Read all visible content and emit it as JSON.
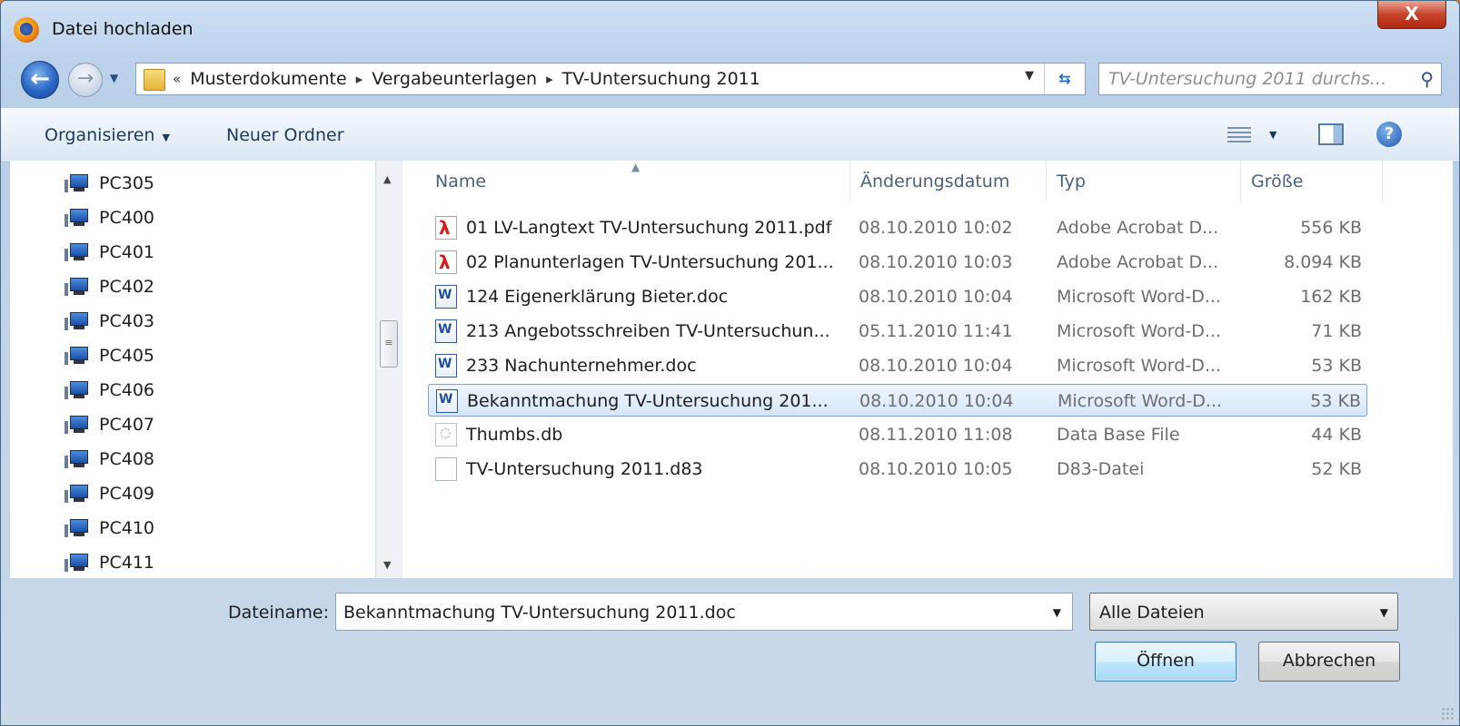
{
  "window": {
    "title": "Datei hochladen",
    "close_label": "X"
  },
  "address": {
    "overflow": "«",
    "crumbs": [
      "Musterdokumente",
      "Vergabeunterlagen",
      "TV-Untersuchung 2011"
    ],
    "separator": "▸",
    "search_placeholder": "TV-Untersuchung 2011 durchs..."
  },
  "toolbar": {
    "organize_label": "Organisieren",
    "new_folder_label": "Neuer Ordner"
  },
  "nav": {
    "items": [
      "PC305",
      "PC400",
      "PC401",
      "PC402",
      "PC403",
      "PC405",
      "PC406",
      "PC407",
      "PC408",
      "PC409",
      "PC410",
      "PC411"
    ]
  },
  "columns": {
    "name": "Name",
    "date": "Änderungsdatum",
    "type": "Typ",
    "size": "Größe"
  },
  "files": [
    {
      "name": "01 LV-Langtext TV-Untersuchung 2011.pdf",
      "date": "08.10.2010 10:02",
      "type": "Adobe Acrobat D...",
      "size": "556 KB",
      "icon": "pdf-icon"
    },
    {
      "name": "02 Planunterlagen TV-Untersuchung 201...",
      "date": "08.10.2010 10:03",
      "type": "Adobe Acrobat D...",
      "size": "8.094 KB",
      "icon": "pdf-icon"
    },
    {
      "name": "124 Eigenerklärung Bieter.doc",
      "date": "08.10.2010 10:04",
      "type": "Microsoft Word-D...",
      "size": "162 KB",
      "icon": "word-doc-icon"
    },
    {
      "name": "213 Angebotsschreiben TV-Untersuchun...",
      "date": "05.11.2010 11:41",
      "type": "Microsoft Word-D...",
      "size": "71 KB",
      "icon": "word-doc-icon"
    },
    {
      "name": "233 Nachunternehmer.doc",
      "date": "08.10.2010 10:04",
      "type": "Microsoft Word-D...",
      "size": "53 KB",
      "icon": "word-doc-icon"
    },
    {
      "name": "Bekanntmachung TV-Untersuchung 201...",
      "date": "08.10.2010 10:04",
      "type": "Microsoft Word-D...",
      "size": "53 KB",
      "icon": "word-doc-icon",
      "selected": true
    },
    {
      "name": "Thumbs.db",
      "date": "08.11.2010 11:08",
      "type": "Data Base File",
      "size": "44 KB",
      "icon": "database-file-icon"
    },
    {
      "name": "TV-Untersuchung 2011.d83",
      "date": "08.10.2010 10:05",
      "type": "D83-Datei",
      "size": "52 KB",
      "icon": "blank-file-icon"
    }
  ],
  "bottom": {
    "filename_label": "Dateiname:",
    "filename_value": "Bekanntmachung TV-Untersuchung 2011.doc",
    "filter_value": "Alle Dateien",
    "open_label": "Öffnen",
    "cancel_label": "Abbrechen"
  },
  "colors": {
    "selection_border": "#7da2ce",
    "accent": "#2a66c5"
  }
}
